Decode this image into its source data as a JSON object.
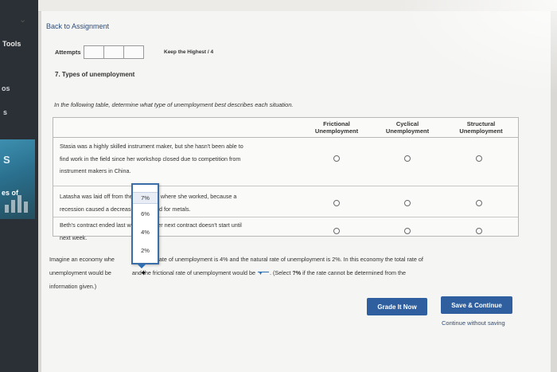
{
  "sidebar": {
    "tools_label": "Tools",
    "frag_os": "os",
    "frag_s": "s",
    "tile_s": "S",
    "tile_es_of": "es of"
  },
  "nav": {
    "back_link": "Back to Assignment"
  },
  "attempts": {
    "label": "Attempts",
    "keep_label": "Keep the Highest / 4"
  },
  "question": {
    "title": "7. Types of unemployment",
    "instruction": "In the following table, determine what type of unemployment best describes each situation."
  },
  "table": {
    "headers": {
      "frictional": [
        "Frictional",
        "Unemployment"
      ],
      "cyclical": [
        "Cyclical",
        "Unemployment"
      ],
      "structural": [
        "Structural",
        "Unemployment"
      ]
    },
    "rows": [
      {
        "lines": [
          "Stasia was a highly skilled instrument maker, but she hasn't been able to",
          "find work in the field since her workshop closed due to competition from",
          "instrument makers in China."
        ]
      },
      {
        "lines": [
          "Latasha was laid off from the gold mine where she worked, because a",
          "recession caused a decrease in demand for metals."
        ]
      },
      {
        "lines": [
          "Beth's contract ended last week, and her next contract doesn't start until",
          "next week."
        ]
      }
    ]
  },
  "dropdown": {
    "options": [
      "7%",
      "6%",
      "4%",
      "2%"
    ],
    "highlighted": "7%"
  },
  "paragraph": {
    "line1_a": "Imagine an economy whe",
    "line1_b": "yclical rate of unemployment is 4% and the natural rate of unemployment is 2%. In this economy the total rate of",
    "line2_a": "unemployment would be",
    "line2_b": "and the frictional rate of unemployment would be",
    "line2_c": ". (Select ",
    "line2_bold": "?%",
    "line2_d": " if the rate cannot be determined from the",
    "line3": "information given.)"
  },
  "actions": {
    "grade": "Grade It Now",
    "save": "Save & Continue",
    "continue_without": "Continue without saving"
  },
  "colors": {
    "button": "#2f5f9e",
    "link": "#2d4d7c",
    "sidebar": "#2b2f36"
  }
}
